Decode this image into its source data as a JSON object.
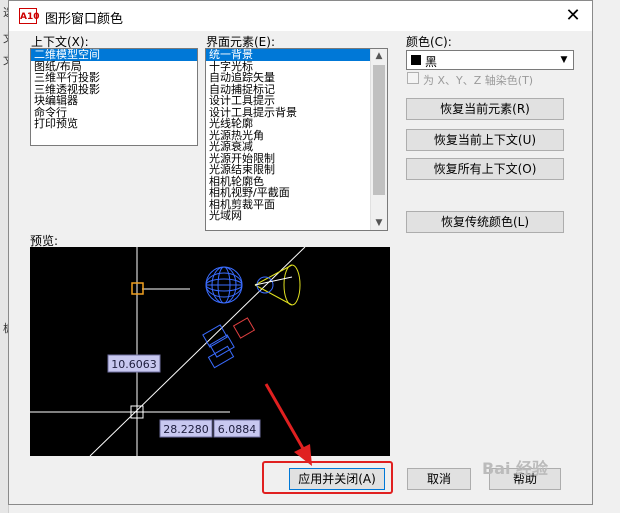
{
  "background": {
    "fragments": [
      "文",
      "文前",
      "置",
      "板",
      "选"
    ]
  },
  "dialog": {
    "title": "图形窗口颜色",
    "app_icon": "A10",
    "close_glyph": "✕"
  },
  "context": {
    "label": "上下文(X):",
    "items": [
      "二维模型空间",
      "图纸/布局",
      "三维平行投影",
      "三维透视投影",
      "块编辑器",
      "命令行",
      "打印预览"
    ],
    "selected_index": 0
  },
  "elements": {
    "label": "界面元素(E):",
    "items": [
      "统一背景",
      "十字光标",
      "自动追踪矢量",
      "自动捕捉标记",
      "设计工具提示",
      "设计工具提示背景",
      "光线轮廓",
      "光源热光角",
      "光源衰减",
      "光源开始限制",
      "光源结束限制",
      "相机轮廓色",
      "相机视野/平截面",
      "相机剪裁平面",
      "光域网"
    ],
    "selected_index": 0
  },
  "color": {
    "label": "颜色(C):",
    "value": "黑",
    "swatch": "#000000",
    "tint_checkbox_label": "为 X、Y、Z 轴染色(T)",
    "tint_checked": false
  },
  "buttons": {
    "restore_element": "恢复当前元素(R)",
    "restore_context": "恢复当前上下文(U)",
    "restore_all": "恢复所有上下文(O)",
    "restore_classic": "恢复传统颜色(L)",
    "apply_close": "应用并关闭(A)",
    "cancel": "取消",
    "help": "帮助"
  },
  "preview": {
    "label": "预览:",
    "dim1": "10.6063",
    "dim2": "28.2280",
    "dim3": "6.0884"
  },
  "watermark": "Bai 经验",
  "colors": {
    "highlight": "#e02020",
    "selection": "#0078d7",
    "preview_bg": "#000000"
  }
}
